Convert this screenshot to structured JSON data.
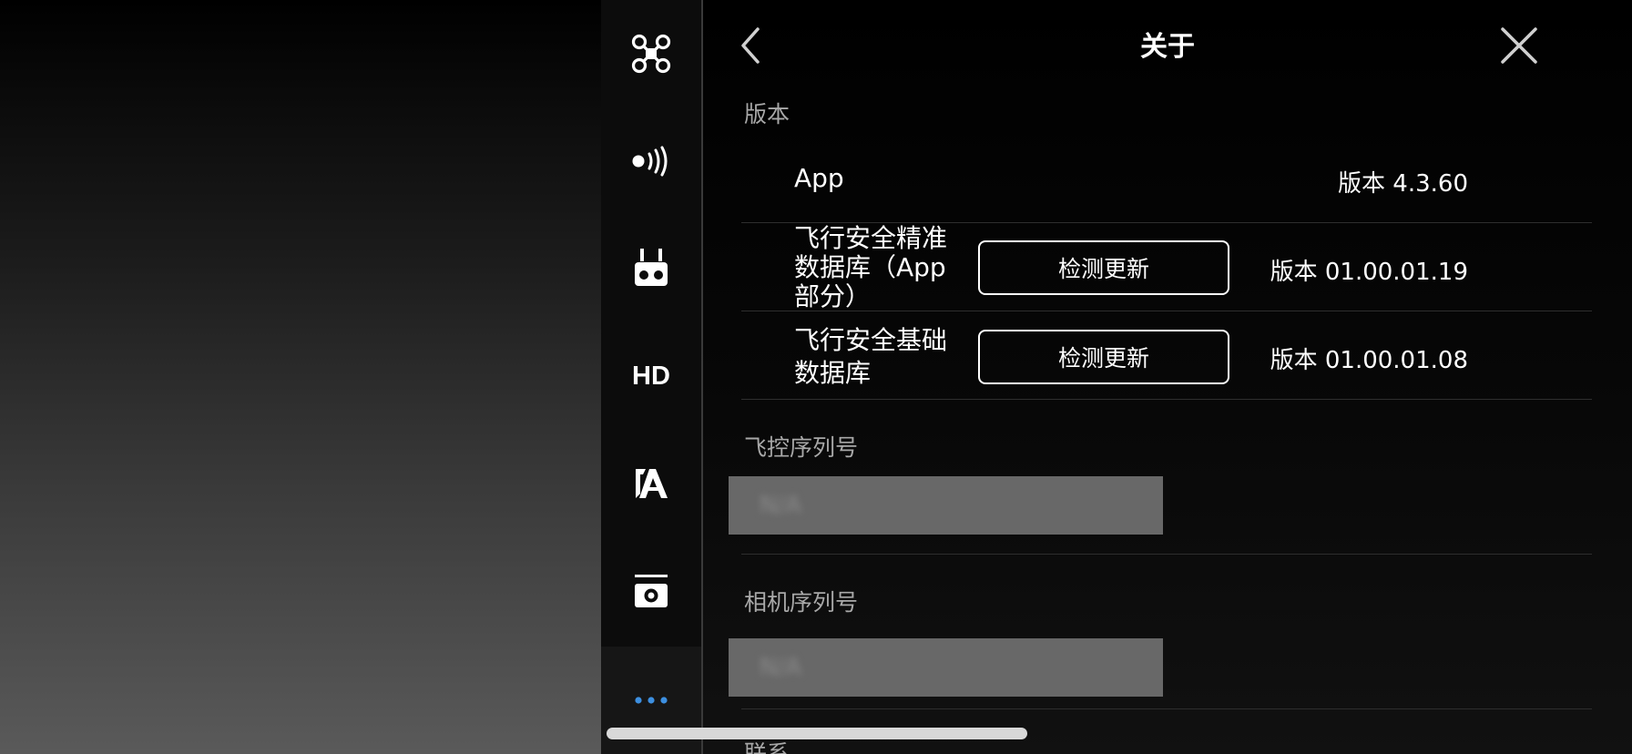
{
  "header": {
    "title": "关于",
    "back_icon": "chevron-left-icon",
    "close_icon": "close-icon"
  },
  "rail": {
    "items": [
      {
        "name": "aircraft",
        "icon": "drone-icon"
      },
      {
        "name": "signal",
        "icon": "signal-icon"
      },
      {
        "name": "remote-controller",
        "icon": "remote-controller-icon"
      },
      {
        "name": "hd",
        "label": "HD"
      },
      {
        "name": "battery",
        "icon": "battery-icon"
      },
      {
        "name": "gimbal-camera",
        "icon": "gimbal-icon"
      },
      {
        "name": "more",
        "icon": "more-icon"
      }
    ],
    "active_color": "#3d8fe0"
  },
  "version": {
    "section_label": "版本",
    "app": {
      "name": "App",
      "version": "版本 4.3.60"
    },
    "precise_db": {
      "name_line1": "飞行安全精准",
      "name_line2": "数据库（App",
      "name_line3": "部分）",
      "button": "检测更新",
      "version": "版本 01.00.01.19"
    },
    "basic_db": {
      "name_line1": "飞行安全基础",
      "name_line2": "数据库",
      "button": "检测更新",
      "version": "版本 01.00.01.08"
    }
  },
  "fc_serial": {
    "label": "飞控序列号",
    "value": "N/A"
  },
  "camera_serial": {
    "label": "相机序列号",
    "value": "N/A"
  },
  "contact": {
    "label": "联系"
  }
}
